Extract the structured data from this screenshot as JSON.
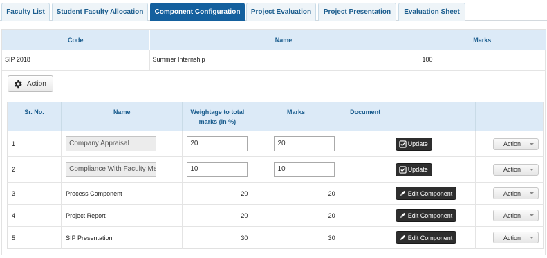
{
  "tabs": [
    {
      "label": "Faculty List",
      "active": false
    },
    {
      "label": "Student Faculty Allocation",
      "active": false
    },
    {
      "label": "Component Configuration",
      "active": true
    },
    {
      "label": "Project Evaluation",
      "active": false
    },
    {
      "label": "Project Presentation",
      "active": false
    },
    {
      "label": "Evaluation Sheet",
      "active": false
    }
  ],
  "summary": {
    "headers": {
      "code": "Code",
      "name": "Name",
      "marks": "Marks"
    },
    "row": {
      "code": "SIP 2018",
      "name": "Summer Internship",
      "marks": "100"
    }
  },
  "action_button": {
    "label": "Action",
    "icon": "gear-icon"
  },
  "grid": {
    "headers": {
      "sr_no": "Sr. No.",
      "name": "Name",
      "weightage": "Weightage to total marks (In %)",
      "marks": "Marks",
      "document": "Document"
    },
    "rows": [
      {
        "sr": "1",
        "name": "Company Appraisal",
        "weightage": "20",
        "marks": "20",
        "button": "Update",
        "action": "Action"
      },
      {
        "sr": "2",
        "name": "Compliance With Faculty Me",
        "weightage": "10",
        "marks": "10",
        "button": "Update",
        "action": "Action"
      },
      {
        "sr": "3",
        "name": "Process Component",
        "weightage": "20",
        "marks": "20",
        "button": "Edit Component",
        "action": "Action"
      },
      {
        "sr": "4",
        "name": "Project Report",
        "weightage": "20",
        "marks": "20",
        "button": "Edit Component",
        "action": "Action"
      },
      {
        "sr": "5",
        "name": "SIP Presentation",
        "weightage": "30",
        "marks": "30",
        "button": "Edit Component",
        "action": "Action"
      }
    ]
  },
  "colors": {
    "accent": "#14609e",
    "header_bg": "#dceaf7",
    "header_text": "#1b5d8e",
    "dark_button": "#2e2e2e"
  }
}
